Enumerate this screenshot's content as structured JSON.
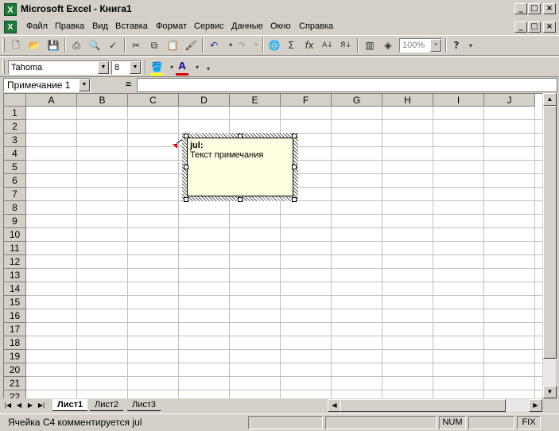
{
  "window": {
    "title": "Microsoft Excel - Книга1",
    "app_icon": "X",
    "minimize": "_",
    "maximize": "□",
    "close": "×"
  },
  "menu": {
    "items": [
      "Файл",
      "Правка",
      "Вид",
      "Вставка",
      "Формат",
      "Сервис",
      "Данные",
      "Окно",
      "Справка"
    ]
  },
  "toolbar": {
    "zoom": "100%",
    "help": "?"
  },
  "formatting": {
    "font": "Tahoma",
    "size": "8"
  },
  "formula": {
    "name_box": "Примечание 1",
    "equals": "="
  },
  "columns": [
    "A",
    "B",
    "C",
    "D",
    "E",
    "F",
    "G",
    "H",
    "I",
    "J"
  ],
  "rows": [
    "1",
    "2",
    "3",
    "4",
    "5",
    "6",
    "7",
    "8",
    "9",
    "10",
    "11",
    "12",
    "13",
    "14",
    "15",
    "16",
    "17",
    "18",
    "19",
    "20",
    "21",
    "22"
  ],
  "comment": {
    "author": "jul:",
    "text": "Текст примечания"
  },
  "sheets": {
    "tabs": [
      "Лист1",
      "Лист2",
      "Лист3"
    ],
    "active": "Лист1"
  },
  "status": {
    "message": "Ячейка C4 комментируется jul",
    "num": "NUM",
    "fix": "FIX"
  }
}
